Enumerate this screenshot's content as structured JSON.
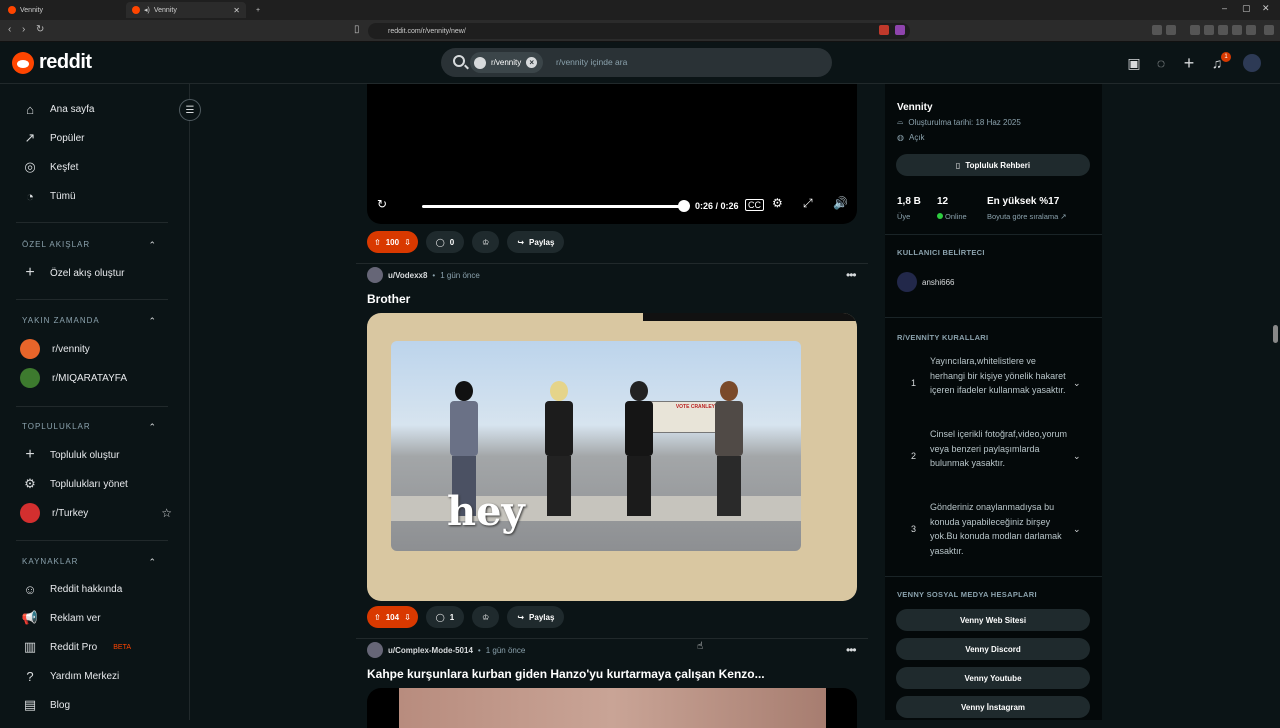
{
  "browser": {
    "tabs": [
      {
        "title": "Vennity",
        "active": false
      },
      {
        "title": "Vennity",
        "active": true
      }
    ],
    "new_tab": "+",
    "url": "reddit.com/r/vennity/new/",
    "window_controls": [
      "–",
      "▢",
      "✕"
    ]
  },
  "header": {
    "logo_text": "reddit",
    "search_chip": "r/vennity",
    "search_placeholder": "r/vennity içinde ara",
    "notification_count": "1"
  },
  "sidebar": {
    "main": [
      {
        "label": "Ana sayfa",
        "icon": "home-icon"
      },
      {
        "label": "Popüler",
        "icon": "popular-icon"
      },
      {
        "label": "Keşfet",
        "icon": "explore-icon"
      },
      {
        "label": "Tümü",
        "icon": "all-icon"
      }
    ],
    "custom_feeds": {
      "title": "ÖZEL AKIŞLAR",
      "create": "Özel akış oluştur"
    },
    "recent": {
      "title": "YAKIN ZAMANDA",
      "items": [
        "r/vennity",
        "r/MIQARATAYFA"
      ]
    },
    "communities": {
      "title": "TOPLULUKLAR",
      "create": "Topluluk oluştur",
      "manage": "Toplulukları yönet",
      "items": [
        "r/Turkey"
      ]
    },
    "resources": {
      "title": "KAYNAKLAR",
      "items": [
        "Reddit hakkında",
        "Reklam ver",
        "Reddit Pro",
        "Yardım Merkezi",
        "Blog"
      ],
      "beta": "BETA"
    }
  },
  "video": {
    "time": "0:26 / 0:26",
    "progress": 1.0
  },
  "posts": [
    {
      "votes": "100",
      "comments": "0",
      "share": "Paylaş"
    },
    {
      "user": "u/Vodexx8",
      "time": "1 gün önce",
      "title": "Brother",
      "image_text": "hey",
      "billboard": "VOTE CRANLEY",
      "votes": "104",
      "comments": "1",
      "share": "Paylaş"
    },
    {
      "user": "u/Complex-Mode-5014",
      "time": "1 gün önce",
      "title": "Kahpe kurşunlara kurban giden Hanzo'yu kurtarmaya çalışan Kenzo..."
    }
  ],
  "right": {
    "name": "Vennity",
    "created": "Oluşturulma tarihi: 18 Haz 2025",
    "visibility": "Açık",
    "guide_button": "Topluluk Rehberi",
    "stats": {
      "members": "1,8 B",
      "members_label": "Üye",
      "online": "12",
      "online_label": "Online",
      "rank": "En yüksek %17",
      "rank_label": "Boyuta göre sıralama"
    },
    "flair_title": "KULLANICI BELİRTECI",
    "flair_user": "anshi666",
    "rules_title": "R/VENNİTY KURALLARI",
    "rules": [
      {
        "n": "1",
        "text": "Yayıncılara,whitelistlere ve herhangi bir kişiye yönelik hakaret içeren ifadeler kullanmak yasaktır."
      },
      {
        "n": "2",
        "text": "Cinsel içerikli fotoğraf,video,yorum veya benzeri paylaşımlarda bulunmak yasaktır."
      },
      {
        "n": "3",
        "text": "Gönderiniz onaylanmadıysa bu konuda yapabileceğiniz birşey yok.Bu konuda modları darlamak yasaktır."
      }
    ],
    "social_title": "VENNY SOSYAL MEDYA HESAPLARI",
    "social": [
      "Venny Web Sitesi",
      "Venny Discord",
      "Venny Youtube",
      "Venny İnstagram"
    ]
  }
}
